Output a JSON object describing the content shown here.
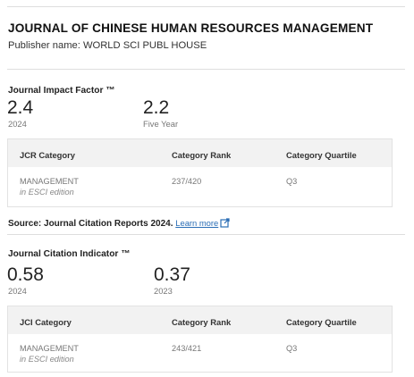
{
  "journal": {
    "title": "JOURNAL OF CHINESE HUMAN RESOURCES MANAGEMENT",
    "publisher": "Publisher name: WORLD SCI PUBL HOUSE"
  },
  "impact_factor": {
    "heading": "Journal Impact Factor ™",
    "current": {
      "value": "2.4",
      "label": "2024"
    },
    "five_year": {
      "value": "2.2",
      "label": "Five Year"
    },
    "table": {
      "headers": [
        "JCR Category",
        "Category Rank",
        "Category Quartile"
      ],
      "rows": [
        {
          "category": "MANAGEMENT",
          "edition": "in ESCI edition",
          "rank": "237/420",
          "quartile": "Q3"
        }
      ]
    }
  },
  "source": {
    "label": "Source: Journal Citation Reports",
    "year": "2024.",
    "link_text": "Learn more",
    "link_icon": "external-link-icon"
  },
  "citation_indicator": {
    "heading": "Journal Citation Indicator ™",
    "current": {
      "value": "0.58",
      "label": "2024"
    },
    "previous": {
      "value": "0.37",
      "label": "2023"
    },
    "table": {
      "headers": [
        "JCI Category",
        "Category Rank",
        "Category Quartile"
      ],
      "rows": [
        {
          "category": "MANAGEMENT",
          "edition": "in ESCI edition",
          "rank": "243/421",
          "quartile": "Q3"
        }
      ]
    }
  },
  "colors": {
    "link": "#2a6db5",
    "table_header_bg": "#f2f2f2",
    "divider": "#dedede"
  }
}
